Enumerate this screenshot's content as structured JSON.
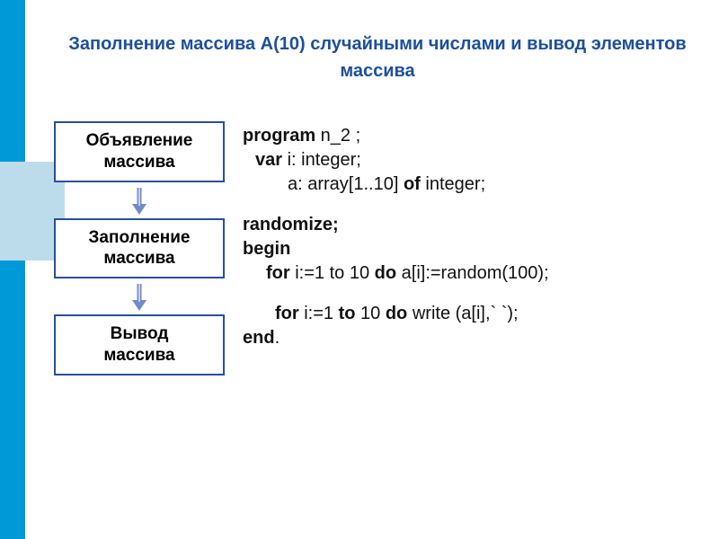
{
  "title": "Заполнение массива A(10) случайными числами и вывод элементов массива",
  "flow": {
    "box1_line1": "Объявление",
    "box1_line2": "массива",
    "box2_line1": "Заполнение",
    "box2_line2": "массива",
    "box3_line1": "Вывод",
    "box3_line2": "массива"
  },
  "code": {
    "b1": {
      "l1a": "program",
      "l1b": "  n_2 ;",
      "l2a": "var",
      "l2b": " i: integer;",
      "l3a": "a: array[1..10] ",
      "l3b": "of",
      "l3c": " integer;"
    },
    "b2": {
      "l1": "randomize;",
      "l2": "begin",
      "l3a": "for",
      "l3b": " i:=1 to 10 ",
      "l3c": "do",
      "l3d": " a[i]:=random(100);"
    },
    "b3": {
      "l1a": "for",
      "l1b": " i:=1 ",
      "l1c": "to",
      "l1d": " 10 ",
      "l1e": "do",
      "l1f": " write (a[i],` `);",
      "l2a": "end",
      "l2b": "."
    }
  }
}
